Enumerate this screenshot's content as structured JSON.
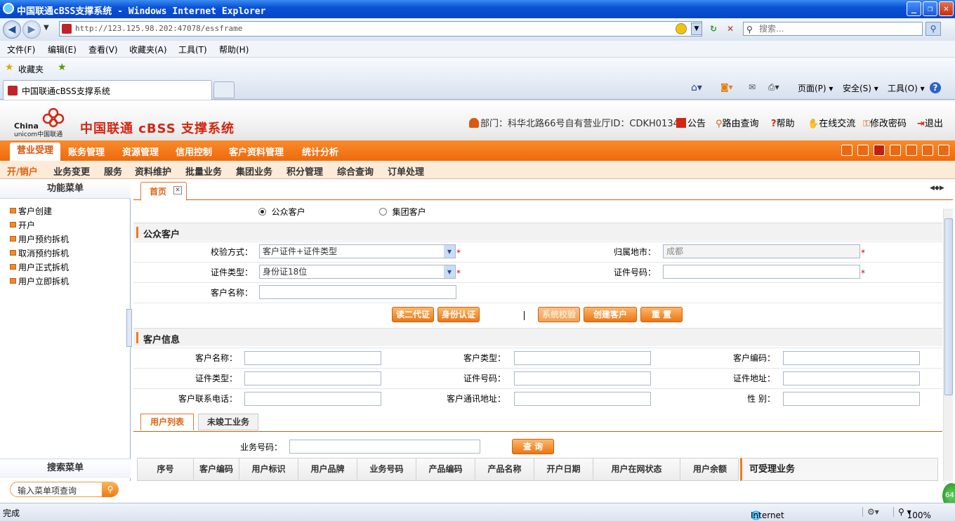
{
  "window": {
    "title": "中国联通cBSS支撑系统 - Windows Internet Explorer"
  },
  "browser": {
    "address": "http://123.125.98.202:47078/essframe",
    "search_placeholder": "搜索...",
    "menu": [
      "文件(F)",
      "编辑(E)",
      "查看(V)",
      "收藏夹(A)",
      "工具(T)",
      "帮助(H)"
    ],
    "favorites_label": "收藏夹",
    "tab_title": "中国联通cBSS支撑系统",
    "commands": {
      "page": "页面(P) ▾",
      "safety": "安全(S) ▾",
      "tools": "工具(O) ▾"
    }
  },
  "app": {
    "brand": "中国联通 cBSS 支撑系统",
    "logo_text": {
      "line1": "China",
      "line2": "unicom中国联通"
    },
    "dept": "部门：科华北路66号自有营业厅ID：CDKH0134",
    "header_links": {
      "notice": "公告",
      "route": "路由查询",
      "help": "帮助",
      "chat": "在线交流",
      "password": "修改密码",
      "logout": "退出"
    },
    "nav1": [
      "营业受理",
      "账务管理",
      "资源管理",
      "信用控制",
      "客户资料管理",
      "统计分析"
    ],
    "nav2": [
      "开/销户",
      "业务变更",
      "服务",
      "资料维护",
      "批量业务",
      "集团业务",
      "积分管理",
      "综合查询",
      "订单处理"
    ]
  },
  "sidebar": {
    "title": "功能菜单",
    "items": [
      "客户创建",
      "开户",
      "用户预约拆机",
      "取消预约拆机",
      "用户正式拆机",
      "用户立即拆机"
    ],
    "search_title": "搜索菜单",
    "search_placeholder": "输入菜单项查询"
  },
  "content": {
    "tab": "首页",
    "customer_type": {
      "public": "公众客户",
      "group": "集团客户"
    },
    "section1": "公众客户",
    "verify_label": "校验方式：",
    "verify_value": "客户证件+证件类型",
    "city_label": "归属地市：",
    "city_value": "成都",
    "idtype_label": "证件类型：",
    "idtype_value": "身份证18位",
    "idno_label": "证件号码：",
    "name_label": "客户名称：",
    "buttons": {
      "read_id": "读二代证",
      "id_auth": "身份认证",
      "sys_check": "系统校验",
      "create": "创建客户",
      "reset": "重 置"
    },
    "section2": "客户信息",
    "info_labels": {
      "cust_name": "客户名称：",
      "cust_type": "客户类型：",
      "cust_code": "客户编码：",
      "id_type": "证件类型：",
      "id_no": "证件号码：",
      "id_addr": "证件地址：",
      "phone": "客户联系电话：",
      "mail_addr": "客户通讯地址：",
      "gender": "性 别："
    },
    "subtabs": [
      "用户列表",
      "未竣工业务"
    ],
    "svc_label": "业务号码：",
    "query_btn": "查 询",
    "table_headers": [
      "序号",
      "客户编码",
      "用户标识",
      "用户品牌",
      "业务号码",
      "产品编码",
      "产品名称",
      "开户日期",
      "用户在网状态",
      "用户余额"
    ],
    "side_title": "可受理业务"
  },
  "status": {
    "left": "完成",
    "zone": "Internet",
    "zoom": "100%"
  }
}
